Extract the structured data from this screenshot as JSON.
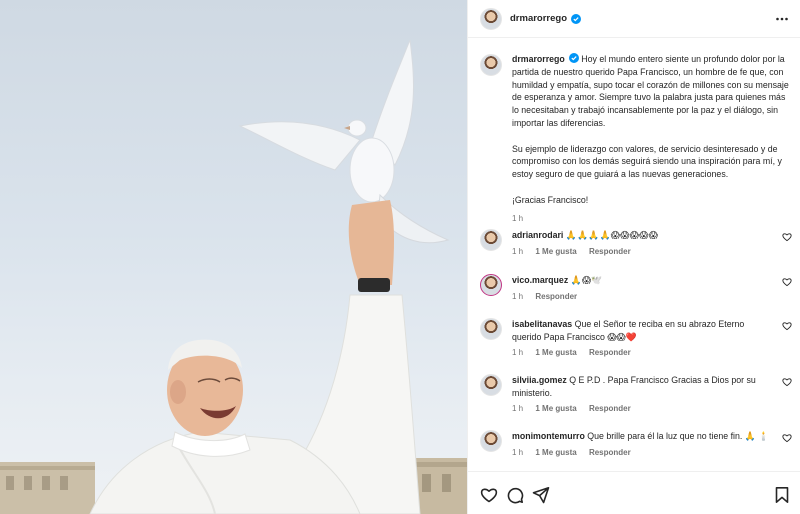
{
  "post": {
    "username": "drmarorrego",
    "caption_paragraphs": [
      "Hoy el mundo entero siente un profundo dolor por la partida de nuestro querido Papa Francisco, un hombre de fe que, con humildad y empatía, supo tocar el corazón de millones con su mensaje de esperanza y amor. Siempre tuvo la palabra justa para quienes más lo necesitaban y trabajó incansablemente por la paz y el diálogo, sin importar las diferencias.",
      "Su ejemplo de liderazgo con valores, de servicio desinteresado y de compromiso con los demás seguirá siendo una inspiración para mí, y estoy seguro de que guiará a las nuevas generaciones.",
      "¡Gracias Francisco!"
    ],
    "time": "1 h"
  },
  "comments": [
    {
      "username": "adrianrodari",
      "text": "🙏🙏🙏🙏😱😱😱😱😱",
      "time": "1 h",
      "likes": "1 Me gusta",
      "reply": "Responder"
    },
    {
      "username": "vico.marquez",
      "text": "🙏😱🕊️",
      "time": "1 h",
      "likes": "",
      "reply": "Responder"
    },
    {
      "username": "isabelitanavas",
      "text": "Que el Señor te reciba en su abrazo Eterno querido Papa Francisco 😱😱❤️",
      "time": "1 h",
      "likes": "1 Me gusta",
      "reply": "Responder"
    },
    {
      "username": "silviia.gomez",
      "text": "Q E P.D . Papa Francisco Gracias a Dios por su ministerio.",
      "time": "1 h",
      "likes": "1 Me gusta",
      "reply": "Responder"
    },
    {
      "username": "monimontemurro",
      "text": "Que brille para él la luz que no tiene fin. 🙏 🕯️",
      "time": "1 h",
      "likes": "1 Me gusta",
      "reply": "Responder"
    }
  ],
  "icons": {
    "verified": "verified-badge-icon",
    "more": "more-options-icon",
    "like": "heart-icon",
    "comment": "comment-icon",
    "share": "paper-plane-icon",
    "save": "bookmark-icon"
  },
  "colors": {
    "verified": "#0095f6",
    "text": "#262626",
    "muted": "#737373",
    "border": "#efefef"
  }
}
